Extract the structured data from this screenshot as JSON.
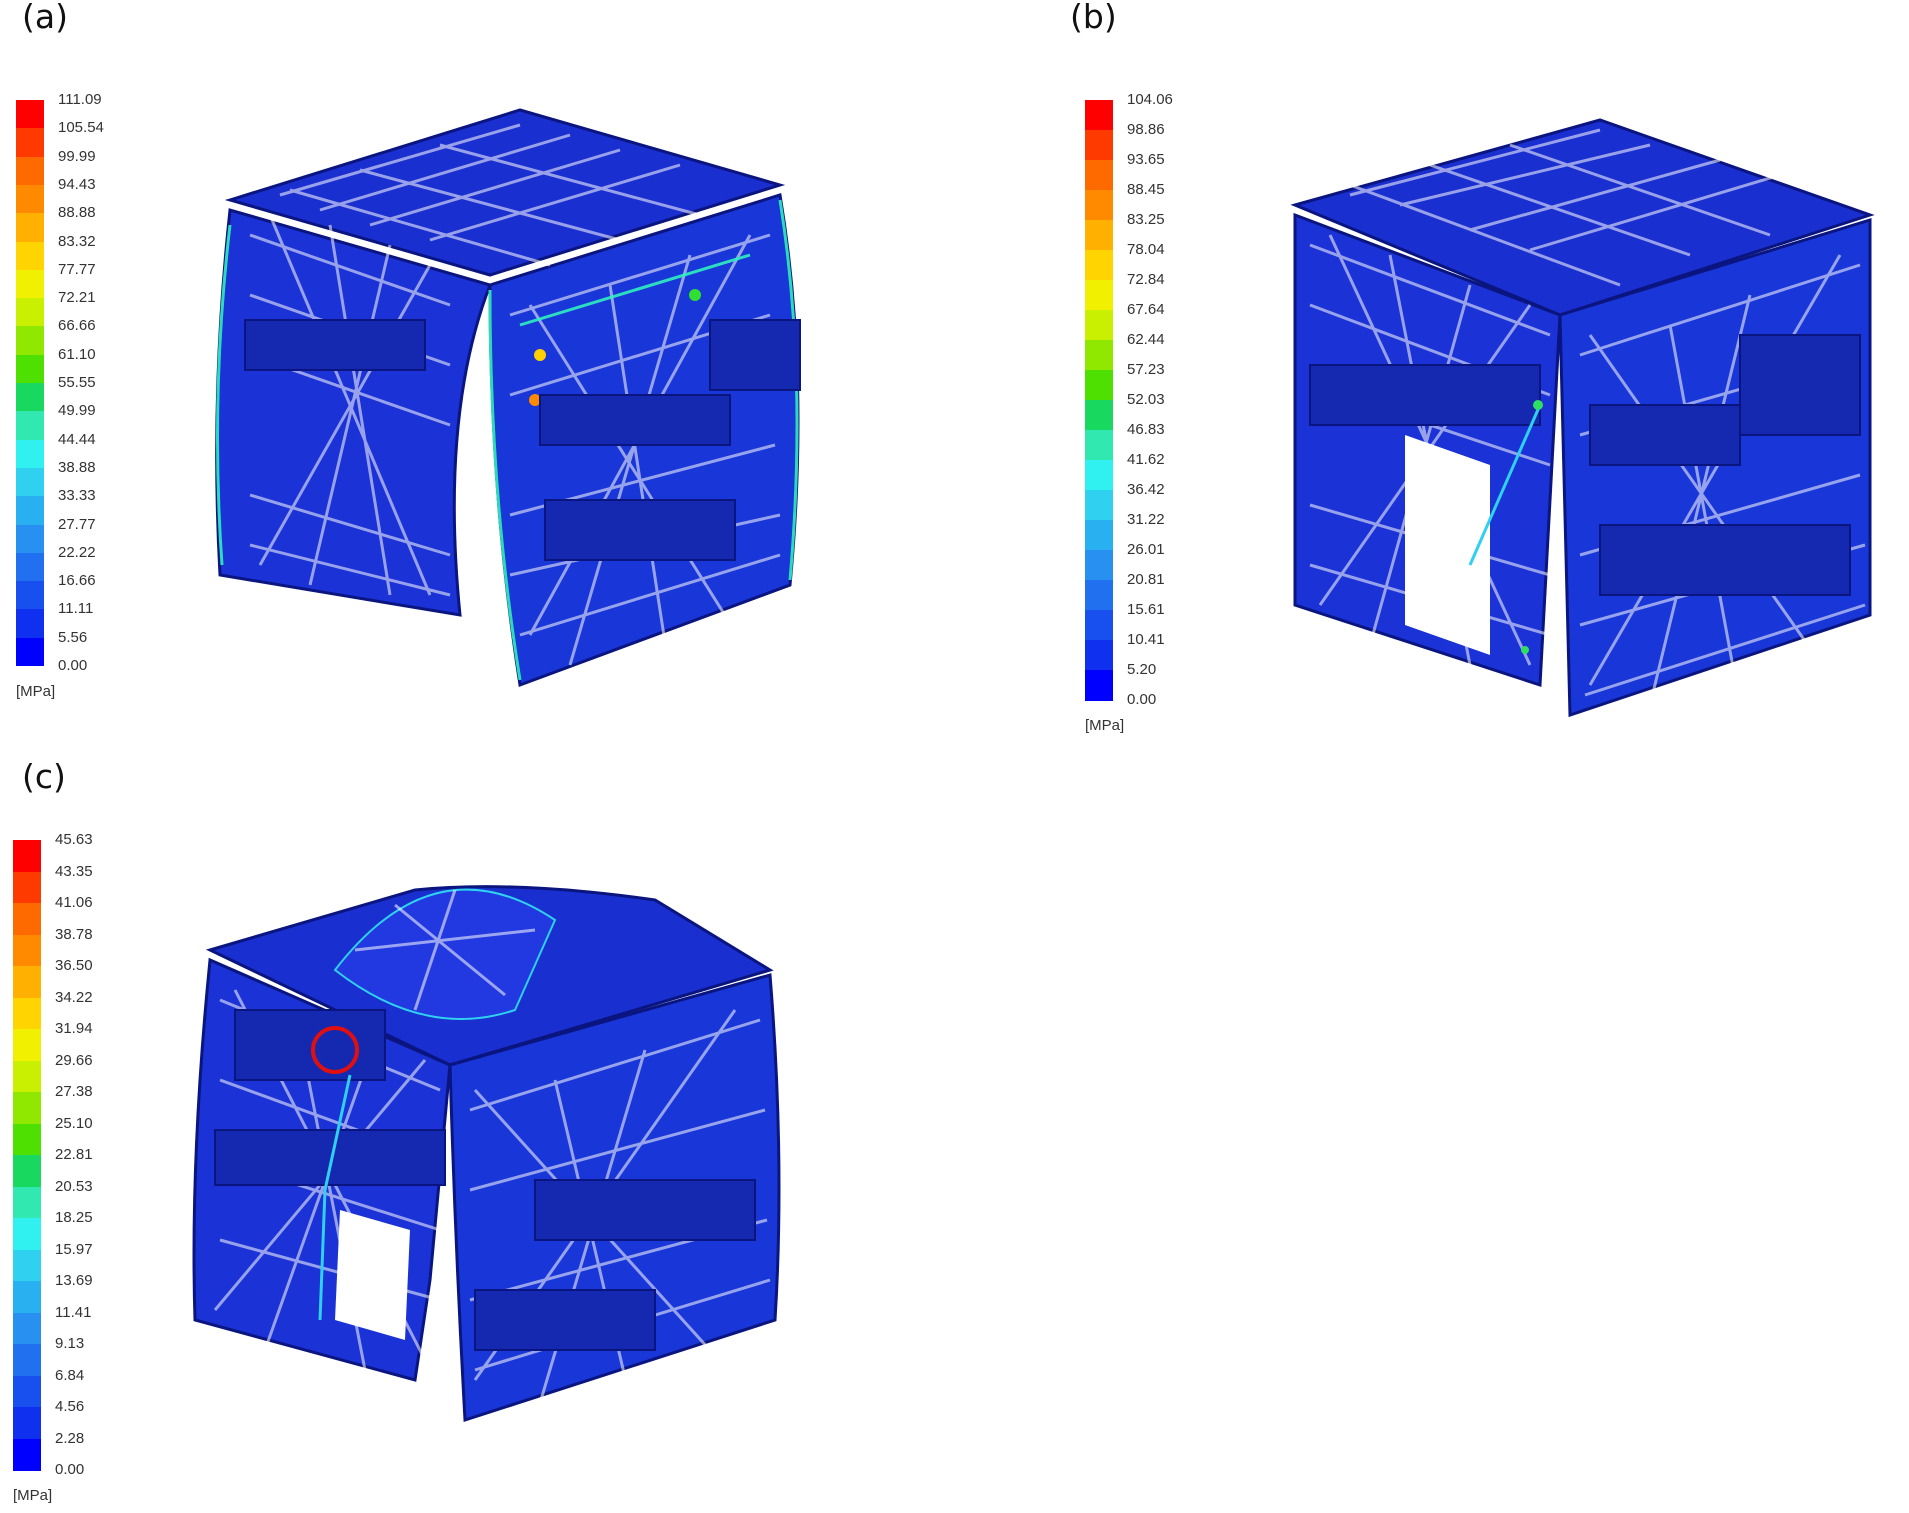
{
  "panels": [
    {
      "label": "(a)",
      "legend": {
        "unit": "[MPa]",
        "values": [
          "111.09",
          "105.54",
          "99.99",
          "94.43",
          "88.88",
          "83.32",
          "77.77",
          "72.21",
          "66.66",
          "61.10",
          "55.55",
          "49.99",
          "44.44",
          "38.88",
          "33.33",
          "27.77",
          "22.22",
          "16.66",
          "11.11",
          "5.56",
          "0.00"
        ]
      }
    },
    {
      "label": "(b)",
      "legend": {
        "unit": "[MPa]",
        "values": [
          "104.06",
          "98.86",
          "93.65",
          "88.45",
          "83.25",
          "78.04",
          "72.84",
          "67.64",
          "62.44",
          "57.23",
          "52.03",
          "46.83",
          "41.62",
          "36.42",
          "31.22",
          "26.01",
          "20.81",
          "15.61",
          "10.41",
          "5.20",
          "0.00"
        ]
      }
    },
    {
      "label": "(c)",
      "legend": {
        "unit": "[MPa]",
        "values": [
          "45.63",
          "43.35",
          "41.06",
          "38.78",
          "36.50",
          "34.22",
          "31.94",
          "29.66",
          "27.38",
          "25.10",
          "22.81",
          "20.53",
          "18.25",
          "15.97",
          "13.69",
          "11.41",
          "9.13",
          "6.84",
          "4.56",
          "2.28",
          "0.00"
        ]
      }
    }
  ],
  "colors": {
    "scale": [
      "#ff0000",
      "#ff3a00",
      "#ff6a00",
      "#ff8a00",
      "#ffb000",
      "#ffd400",
      "#f0f000",
      "#c8f000",
      "#90e800",
      "#4ee000",
      "#18d818",
      "#18d860",
      "#30e8b0",
      "#30f0f0",
      "#30d0f0",
      "#28b0f0",
      "#2890f0",
      "#2070f0",
      "#1850f0",
      "#1030f0",
      "#0000ff"
    ],
    "structure": "#1a2fd0",
    "structure_dark": "#0a1580",
    "highlight_circle": "#e01010"
  }
}
